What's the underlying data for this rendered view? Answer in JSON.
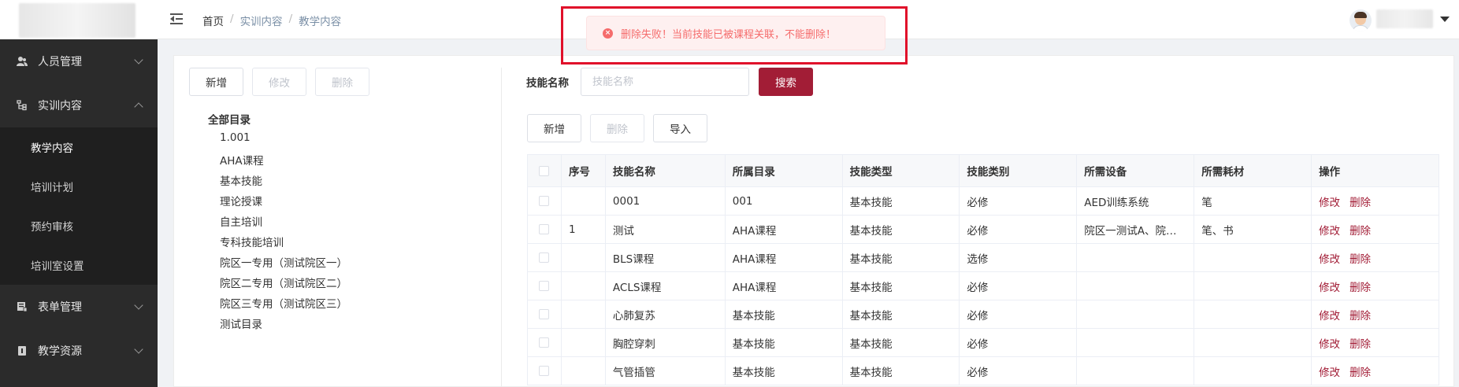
{
  "sidebar": {
    "groups": [
      {
        "label": "人员管理",
        "icon": "user-icon",
        "expanded": false
      },
      {
        "label": "实训内容",
        "icon": "tree-icon",
        "expanded": true
      },
      {
        "label": "表单管理",
        "icon": "form-icon",
        "expanded": false
      },
      {
        "label": "教学资源",
        "icon": "resource-icon",
        "expanded": false
      }
    ],
    "sub_items": [
      {
        "label": "教学内容",
        "active": true
      },
      {
        "label": "培训计划"
      },
      {
        "label": "预约审核"
      },
      {
        "label": "培训室设置"
      }
    ]
  },
  "header": {
    "breadcrumb": [
      "首页",
      "实训内容",
      "教学内容"
    ]
  },
  "left_panel": {
    "buttons": {
      "add": "新增",
      "edit": "修改",
      "delete": "删除"
    },
    "tree_root": "全部目录",
    "tree_nodes": [
      "1.001",
      "AHA课程",
      "基本技能",
      "理论授课",
      "自主培训",
      "专科技能培训",
      "院区一专用（测试院区一）",
      "院区二专用（测试院区二）",
      "院区三专用（测试院区三）",
      "测试目录"
    ]
  },
  "search": {
    "label": "技能名称",
    "placeholder": "技能名称",
    "button": "搜索"
  },
  "toolbar": {
    "add": "新增",
    "delete": "删除",
    "import": "导入"
  },
  "table": {
    "headers": [
      "序号",
      "技能名称",
      "所属目录",
      "技能类型",
      "技能类别",
      "所需设备",
      "所需耗材",
      "操作"
    ],
    "op_edit": "修改",
    "op_delete": "删除",
    "rows": [
      {
        "index": "",
        "name": "0001",
        "catalog": "001",
        "type": "基本技能",
        "category": "必修",
        "equipment": "AED训练系统",
        "consumables": "笔"
      },
      {
        "index": "1",
        "name": "测试",
        "catalog": "AHA课程",
        "type": "基本技能",
        "category": "必修",
        "equipment": "院区一测试A、院…",
        "consumables": "笔、书"
      },
      {
        "index": "",
        "name": "BLS课程",
        "catalog": "AHA课程",
        "type": "基本技能",
        "category": "选修",
        "equipment": "",
        "consumables": ""
      },
      {
        "index": "",
        "name": "ACLS课程",
        "catalog": "AHA课程",
        "type": "基本技能",
        "category": "必修",
        "equipment": "",
        "consumables": ""
      },
      {
        "index": "",
        "name": "心肺复苏",
        "catalog": "基本技能",
        "type": "基本技能",
        "category": "必修",
        "equipment": "",
        "consumables": ""
      },
      {
        "index": "",
        "name": "胸腔穿刺",
        "catalog": "基本技能",
        "type": "基本技能",
        "category": "必修",
        "equipment": "",
        "consumables": ""
      },
      {
        "index": "",
        "name": "气管插管",
        "catalog": "基本技能",
        "type": "基本技能",
        "category": "必修",
        "equipment": "",
        "consumables": ""
      }
    ]
  },
  "toast": {
    "type": "error",
    "message": "删除失败！当前技能已被课程关联，不能删除！"
  },
  "colors": {
    "primary": "#a21d36",
    "sidebar_bg": "#2b2b2b",
    "error": "#f56c6c",
    "highlight_frame": "#e0102a"
  }
}
